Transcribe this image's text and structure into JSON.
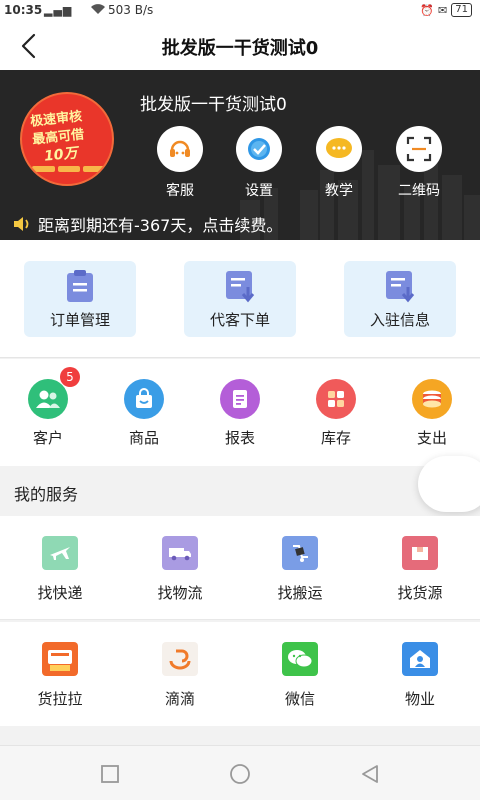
{
  "status_bar": {
    "time": "10:35",
    "network": "4G",
    "speed": "503 B/s",
    "battery": "71"
  },
  "title_bar": {
    "title": "批发版一干货测试0"
  },
  "header": {
    "shop_name": "批发版一干货测试0",
    "logo_text": [
      "极速审核",
      "最高可借",
      "10万"
    ],
    "quick_actions": [
      {
        "label": "客服",
        "icon": "headset-icon"
      },
      {
        "label": "设置",
        "icon": "gear-icon"
      },
      {
        "label": "教学",
        "icon": "chat-bubble-icon"
      },
      {
        "label": "二维码",
        "icon": "qrcode-icon"
      }
    ],
    "notice": "距离到期还有-367天，点击续费。"
  },
  "big_actions": [
    {
      "label": "订单管理",
      "icon": "clipboard-icon"
    },
    {
      "label": "代客下单",
      "icon": "order-download-icon"
    },
    {
      "label": "入驻信息",
      "icon": "document-download-icon"
    }
  ],
  "menu": [
    {
      "label": "客户",
      "icon": "customers-icon",
      "color": "#2fbf7a",
      "badge": "5"
    },
    {
      "label": "商品",
      "icon": "shopping-bag-icon",
      "color": "#3a9de6"
    },
    {
      "label": "报表",
      "icon": "report-icon",
      "color": "#b45ed8"
    },
    {
      "label": "库存",
      "icon": "inventory-icon",
      "color": "#f05a5a"
    },
    {
      "label": "支出",
      "icon": "coins-icon",
      "color": "#f5a623"
    }
  ],
  "services": {
    "title": "我的服务",
    "row1": [
      {
        "label": "找快递",
        "icon": "airplane-icon",
        "color": "#8fd9b4"
      },
      {
        "label": "找物流",
        "icon": "truck-icon",
        "color": "#a99be2"
      },
      {
        "label": "找搬运",
        "icon": "cart-icon",
        "color": "#7a9de6"
      },
      {
        "label": "找货源",
        "icon": "box-icon",
        "color": "#e56b7a"
      }
    ],
    "row2": [
      {
        "label": "货拉拉",
        "icon": "huolala-icon",
        "color": "#f26a2a"
      },
      {
        "label": "滴滴",
        "icon": "didi-icon",
        "color": "#f5f0eb"
      },
      {
        "label": "微信",
        "icon": "wechat-icon",
        "color": "#3ec34a"
      },
      {
        "label": "物业",
        "icon": "property-icon",
        "color": "#3a8ee6"
      }
    ]
  }
}
